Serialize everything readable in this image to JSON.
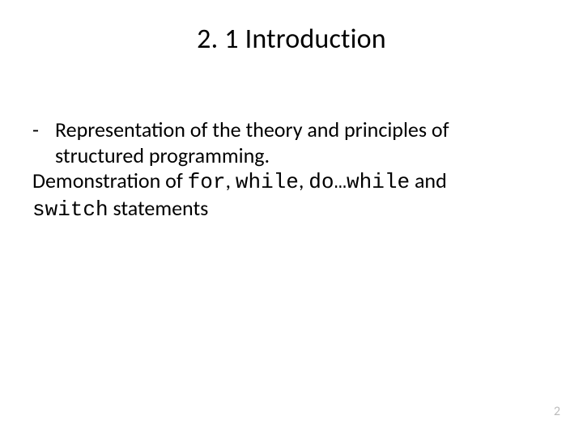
{
  "title": "2. 1 Introduction",
  "bullet": {
    "dash": "-",
    "line1": "Representation of the theory and principles of",
    "line2": "structured programming."
  },
  "demo": {
    "prefix": "Demonstration of ",
    "kw_for": "for",
    "sep1": ", ",
    "kw_while": "while",
    "sep2": ", ",
    "kw_dowhile": "do…while",
    "mid": " and",
    "kw_switch": "switch",
    "suffix": " statements"
  },
  "page_number": "2"
}
